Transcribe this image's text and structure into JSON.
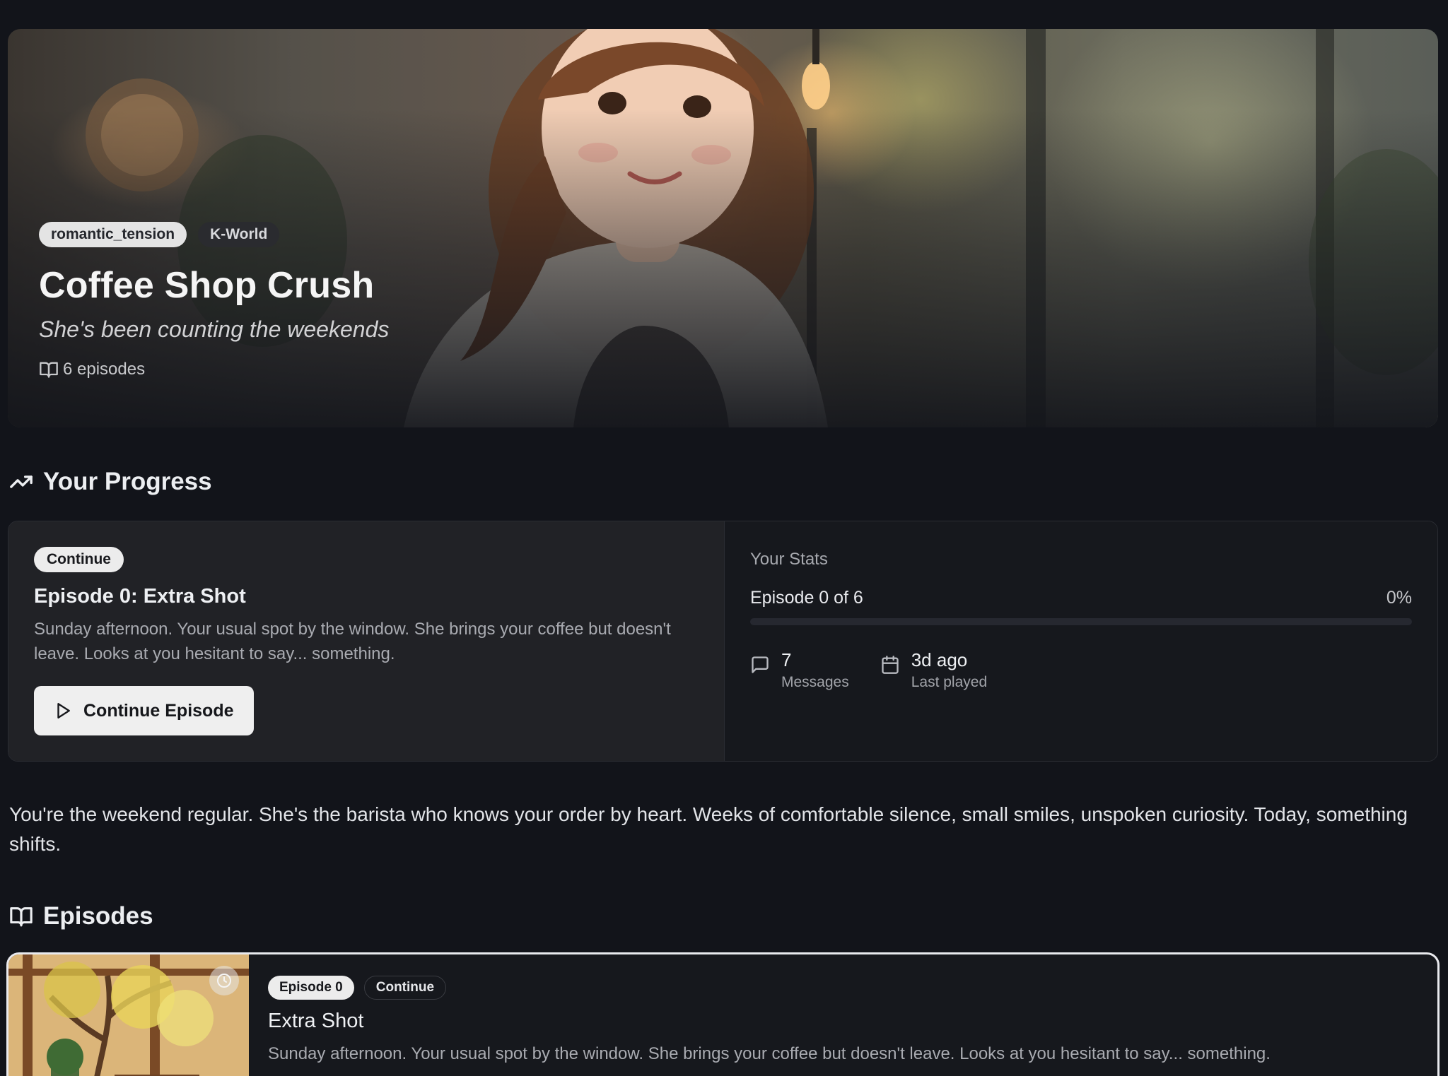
{
  "hero": {
    "tags": [
      "romantic_tension",
      "K-World"
    ],
    "title": "Coffee Shop Crush",
    "subtitle": "She's been counting the weekends",
    "episodes_count": "6 episodes"
  },
  "progress_section": {
    "heading": "Your Progress",
    "current": {
      "badge": "Continue",
      "title": "Episode 0: Extra Shot",
      "description": "Sunday afternoon. Your usual spot by the window. She brings your coffee but doesn't leave. Looks at you hesitant to say... something.",
      "button_label": "Continue Episode"
    },
    "stats": {
      "title": "Your Stats",
      "episode_progress": "Episode 0 of 6",
      "percent_label": "0%",
      "percent_value": 0,
      "messages_value": "7",
      "messages_label": "Messages",
      "last_played_value": "3d ago",
      "last_played_label": "Last played"
    }
  },
  "description": "You're the weekend regular. She's the barista who knows your order by heart. Weeks of comfortable silence, small smiles, unspoken curiosity. Today, something shifts.",
  "episodes_section": {
    "heading": "Episodes",
    "items": [
      {
        "number_badge": "Episode 0",
        "status_badge": "Continue",
        "title": "Extra Shot",
        "description": "Sunday afternoon. Your usual spot by the window. She brings your coffee but doesn't leave. Looks at you hesitant to say... something."
      }
    ]
  },
  "colors": {
    "background": "#12141a",
    "card": "#212226",
    "accent_light": "#ececec"
  }
}
